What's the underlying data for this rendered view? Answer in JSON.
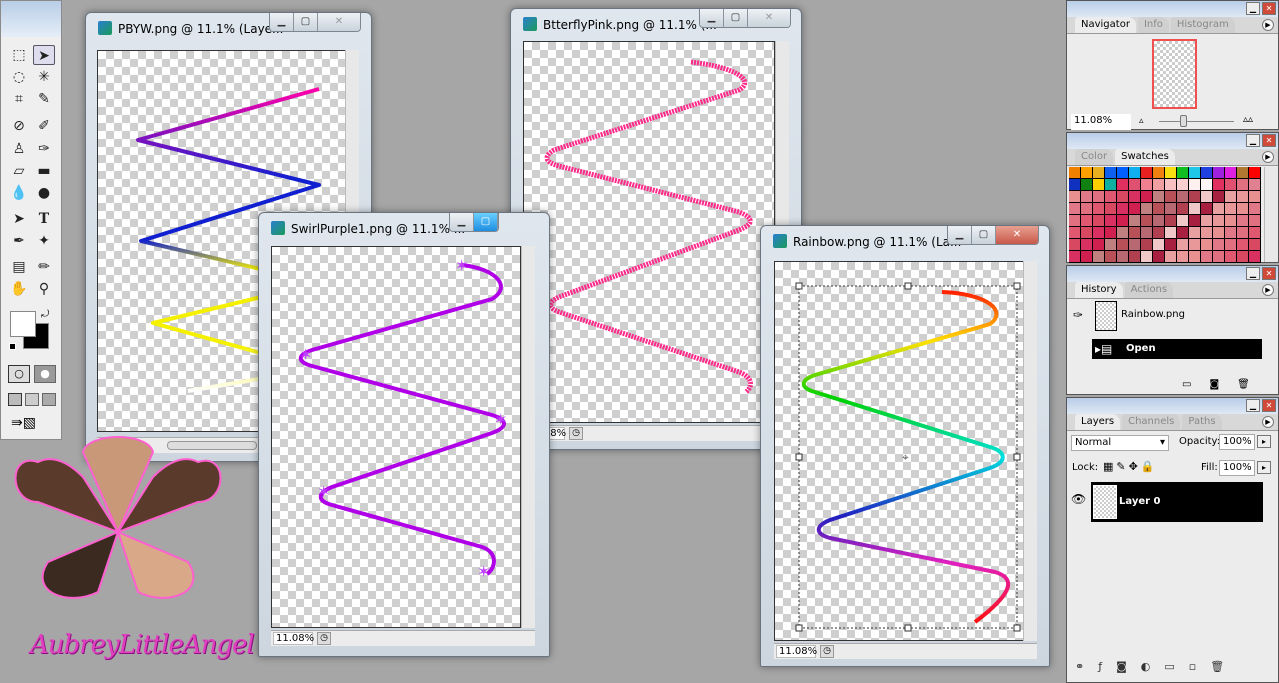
{
  "toolbox": {
    "tools": [
      "rectangular-marquee",
      "move",
      "lasso",
      "magic-wand",
      "crop",
      "slice",
      "healing-brush",
      "brush",
      "clone-stamp",
      "history-brush",
      "eraser",
      "gradient",
      "blur",
      "dodge",
      "path-selection",
      "type",
      "pen",
      "custom-shape",
      "notes",
      "eyedropper",
      "hand",
      "zoom"
    ],
    "type_glyph": "T"
  },
  "windows": [
    {
      "title": "PBYW.png @ 11.1% (Laye...",
      "colors": [
        "#ff00aa",
        "#1020d0",
        "#f5f000",
        "#ffffff"
      ]
    },
    {
      "title": "BtterflyPink.png @ 11.1% (...",
      "zoom": "11.08%",
      "colors": [
        "#ff2a8a",
        "#ff88c0"
      ]
    },
    {
      "title": "SwirlPurple1.png @ 11.1% ...",
      "zoom": "11.08%",
      "colors": [
        "#b000e8",
        "#d060ff"
      ]
    },
    {
      "title": "Rainbow.png @ 11.1% (La...",
      "zoom": "11.08%",
      "colors": [
        "#ff2000",
        "#ffe000",
        "#00d000",
        "#00e0e0",
        "#2020c0",
        "#e020c0",
        "#ff1010"
      ]
    }
  ],
  "navigator": {
    "tabs": [
      "Navigator",
      "Info",
      "Histogram"
    ],
    "zoom": "11.08%",
    "view_box_color": "#f05050"
  },
  "swatches": {
    "tabs": [
      "Color",
      "Swatches"
    ],
    "colors": [
      "#f08000",
      "#ffa000",
      "#e8b020",
      "#1060f0",
      "#0060ff",
      "#10b0f0",
      "#e82020",
      "#f08010",
      "#f8e010",
      "#10c020",
      "#20c8e8",
      "#2040e0",
      "#a020e0",
      "#e020e0",
      "#b07830",
      "#ff0000",
      "#1030c0",
      "#108010",
      "#ffd000",
      "#10b0a0",
      "#e03060",
      "#e05070",
      "#f08090",
      "#f0a0a0",
      "#f8c0c0",
      "#f8d0d0",
      "#fff0f0",
      "#fff8f8",
      "#e03060",
      "#e05070",
      "#e07080",
      "#e08090"
    ]
  },
  "history": {
    "tabs": [
      "History",
      "Actions"
    ],
    "snapshot": "Rainbow.png",
    "states": [
      "Open"
    ]
  },
  "layers": {
    "tabs": [
      "Layers",
      "Channels",
      "Paths"
    ],
    "blend_mode": "Normal",
    "opacity_label": "Opacity:",
    "opacity": "100%",
    "lock_label": "Lock:",
    "fill_label": "Fill:",
    "fill": "100%",
    "items": [
      {
        "name": "Layer 0",
        "visible": true
      }
    ]
  },
  "logo": {
    "text": "AubreyLittleAngel"
  }
}
